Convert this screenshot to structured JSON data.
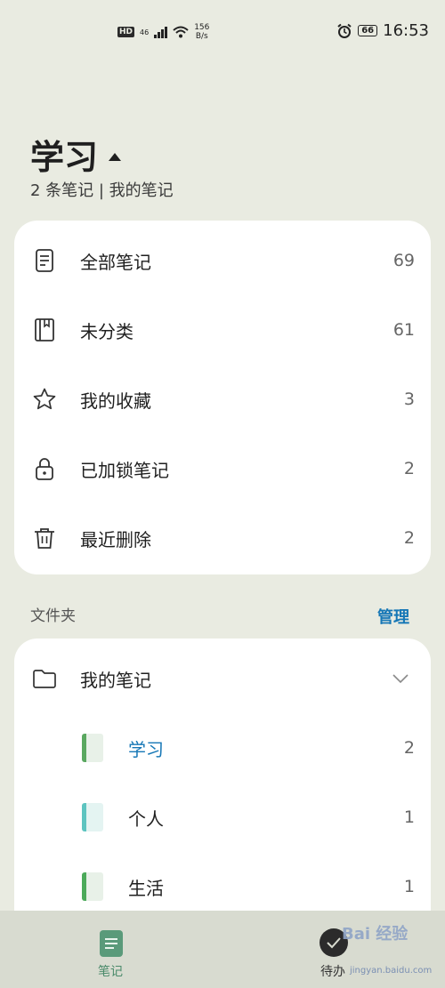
{
  "status_bar": {
    "network_badge": "HD",
    "signal_type": "46",
    "speed_value": "156",
    "speed_unit": "B/s",
    "battery": "66",
    "time": "16:53"
  },
  "header": {
    "title": "学习",
    "subtitle": "2 条笔记 | 我的笔记"
  },
  "categories": [
    {
      "label": "全部笔记",
      "count": "69",
      "icon": "note-icon"
    },
    {
      "label": "未分类",
      "count": "61",
      "icon": "book-icon"
    },
    {
      "label": "我的收藏",
      "count": "3",
      "icon": "star-icon"
    },
    {
      "label": "已加锁笔记",
      "count": "2",
      "icon": "lock-icon"
    },
    {
      "label": "最近删除",
      "count": "2",
      "icon": "trash-icon"
    }
  ],
  "folders_section": {
    "title": "文件夹",
    "manage_label": "管理"
  },
  "folder": {
    "label": "我的笔记",
    "children": [
      {
        "label": "学习",
        "count": "2",
        "color": "#5aa860",
        "active": true
      },
      {
        "label": "个人",
        "count": "1",
        "color": "#5dc4c0",
        "active": false
      },
      {
        "label": "生活",
        "count": "1",
        "color": "#4caa5a",
        "active": false
      }
    ]
  },
  "bottom_nav": {
    "notes_label": "笔记",
    "todo_label": "待办"
  },
  "watermark": {
    "text": "Bai 经验",
    "url": "jingyan.baidu.com"
  },
  "colors": {
    "accent": "#1677b6",
    "background": "#e9ebe1",
    "card": "#ffffff"
  }
}
